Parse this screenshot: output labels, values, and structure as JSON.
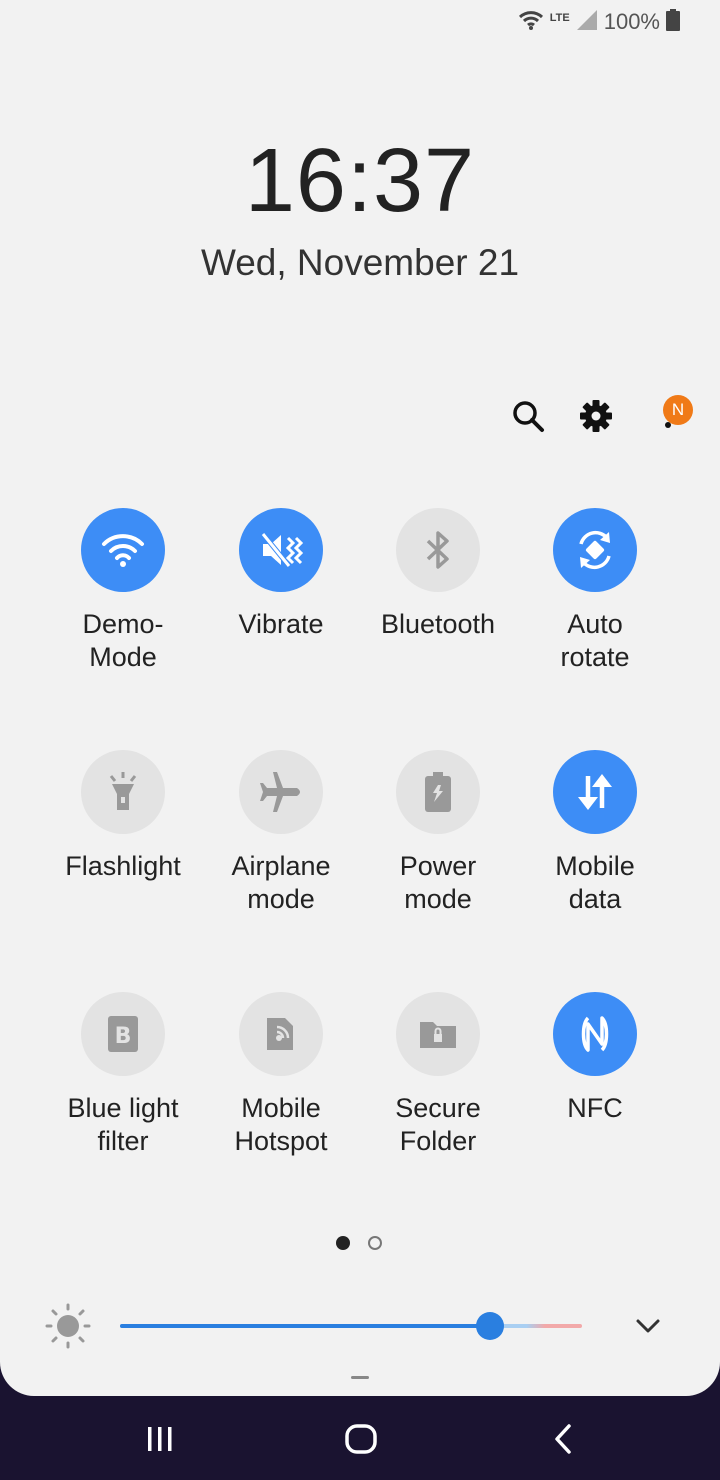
{
  "status_bar": {
    "network_type": "LTE",
    "battery_percent": "100%",
    "icons": [
      "wifi-icon",
      "signal-icon",
      "battery-icon"
    ]
  },
  "clock": {
    "time": "16:37",
    "date": "Wed, November 21"
  },
  "top_actions": {
    "icons": [
      "search-icon",
      "settings-gear-icon",
      "more-options-icon"
    ],
    "notification_badge": "N",
    "badge_color": "#f07a17"
  },
  "tiles": [
    {
      "label": "Demo-\nMode",
      "icon": "wifi-icon",
      "active": true
    },
    {
      "label": "Vibrate",
      "icon": "vibrate-icon",
      "active": true
    },
    {
      "label": "Bluetooth",
      "icon": "bluetooth-icon",
      "active": false
    },
    {
      "label": "Auto\nrotate",
      "icon": "auto-rotate-icon",
      "active": true
    },
    {
      "label": "Flashlight",
      "icon": "flashlight-icon",
      "active": false
    },
    {
      "label": "Airplane\nmode",
      "icon": "airplane-icon",
      "active": false
    },
    {
      "label": "Power\nmode",
      "icon": "power-mode-icon",
      "active": false
    },
    {
      "label": "Mobile\ndata",
      "icon": "mobile-data-icon",
      "active": true
    },
    {
      "label": "Blue light\nfilter",
      "icon": "blue-light-filter-icon",
      "active": false
    },
    {
      "label": "Mobile\nHotspot",
      "icon": "hotspot-icon",
      "active": false
    },
    {
      "label": "Secure\nFolder",
      "icon": "secure-folder-icon",
      "active": false
    },
    {
      "label": "NFC",
      "icon": "nfc-icon",
      "active": true
    }
  ],
  "pager": {
    "pages": 2,
    "current": 1
  },
  "brightness": {
    "level": 0.8
  },
  "colors": {
    "accent": "#3d8df6",
    "slider": "#2a7fe0",
    "panel_bg": "#f2f2f2",
    "nav_bg": "#1a1330"
  },
  "navigation": {
    "icons": [
      "recents-icon",
      "home-icon",
      "back-icon"
    ]
  }
}
